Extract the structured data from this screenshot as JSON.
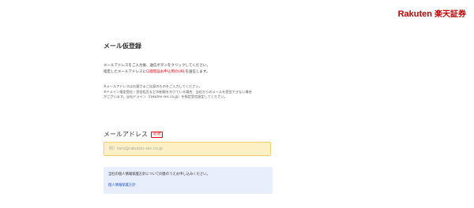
{
  "header": {
    "logo_latin": "Rakuten",
    "logo_japanese": "楽天証券"
  },
  "main": {
    "title": "メール仮登録",
    "intro_line1": "メールアドレスをご入力後、送信ボタンをクリックしてください。",
    "intro_line2_prefix": "指定したメールアドレスに",
    "intro_line2_highlight": "口座開設お申込用のURL",
    "intro_line2_suffix": "を送信します。",
    "note1": "※メールアドレスはお客さまご自身のものをご入力してください。",
    "note2": "※ドメイン指定受信・受信拒否などの制限をかけている場合、当社からのメールを受信できない場合",
    "note3": "がございます。当社ドメイン（rakuten-sec.co.jp）を指定受信設定してください。"
  },
  "email_field": {
    "label": "メールアドレス",
    "required_badge": "必須",
    "value": "",
    "placeholder": "例）taro@rakuten-sec.co.jp"
  },
  "privacy": {
    "text": "当社の個人情報保護方針について同意のうえお申し込みください。",
    "link_label": "個人情報保護方針"
  },
  "colors": {
    "brand": "#bf0000",
    "highlight": "#e60012",
    "input_background": "#fdf0c4",
    "privacy_background": "#e8eefc",
    "link": "#1a56c4"
  }
}
